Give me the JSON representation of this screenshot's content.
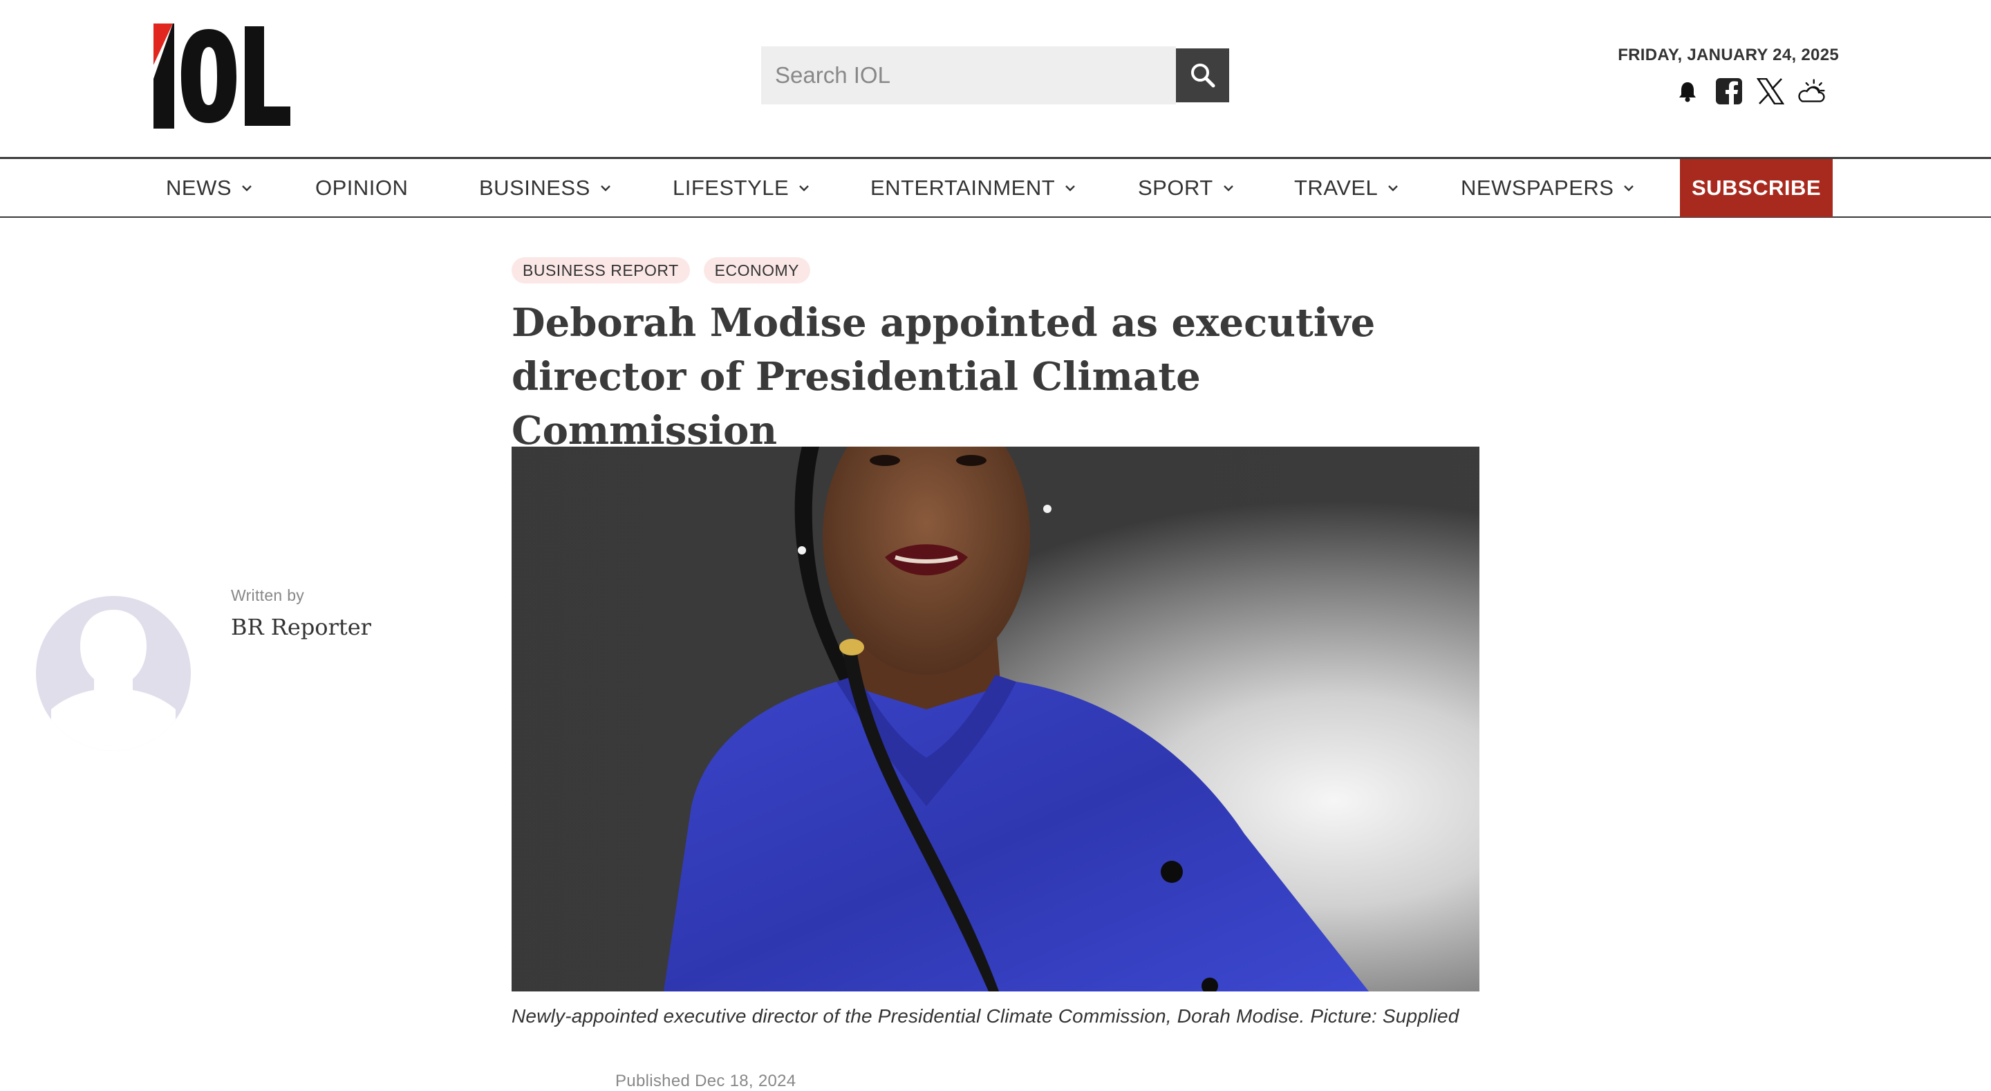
{
  "header": {
    "logo_text": "IOL",
    "search": {
      "placeholder": "Search IOL",
      "value": ""
    },
    "search_button_icon": "search-icon",
    "date": "FRIDAY, JANUARY 24, 2025",
    "icons": [
      "bell-icon",
      "facebook-icon",
      "x-icon",
      "weather-icon"
    ]
  },
  "nav": {
    "items": [
      {
        "label": "NEWS",
        "has_dropdown": true
      },
      {
        "label": "OPINION",
        "has_dropdown": false
      },
      {
        "label": "BUSINESS",
        "has_dropdown": true
      },
      {
        "label": "LIFESTYLE",
        "has_dropdown": true
      },
      {
        "label": "ENTERTAINMENT",
        "has_dropdown": true
      },
      {
        "label": "SPORT",
        "has_dropdown": true
      },
      {
        "label": "TRAVEL",
        "has_dropdown": true
      },
      {
        "label": "NEWSPAPERS",
        "has_dropdown": true
      }
    ],
    "subscribe_label": "SUBSCRIBE"
  },
  "article": {
    "tags": [
      "BUSINESS REPORT",
      "ECONOMY"
    ],
    "headline": "Deborah Modise appointed as executive director of Presidential Climate Commission",
    "caption": "Newly-appointed executive director of the Presidential Climate Commission, Dorah Modise. Picture: Supplied",
    "published": "Published Dec 18, 2024"
  },
  "author": {
    "written_by_label": "Written by",
    "name": "BR Reporter"
  },
  "colors": {
    "brand_red": "#a82a1f",
    "logo_red": "#e0261f",
    "tag_bg": "#fbe8e6",
    "nav_border": "#3a3a3a"
  }
}
